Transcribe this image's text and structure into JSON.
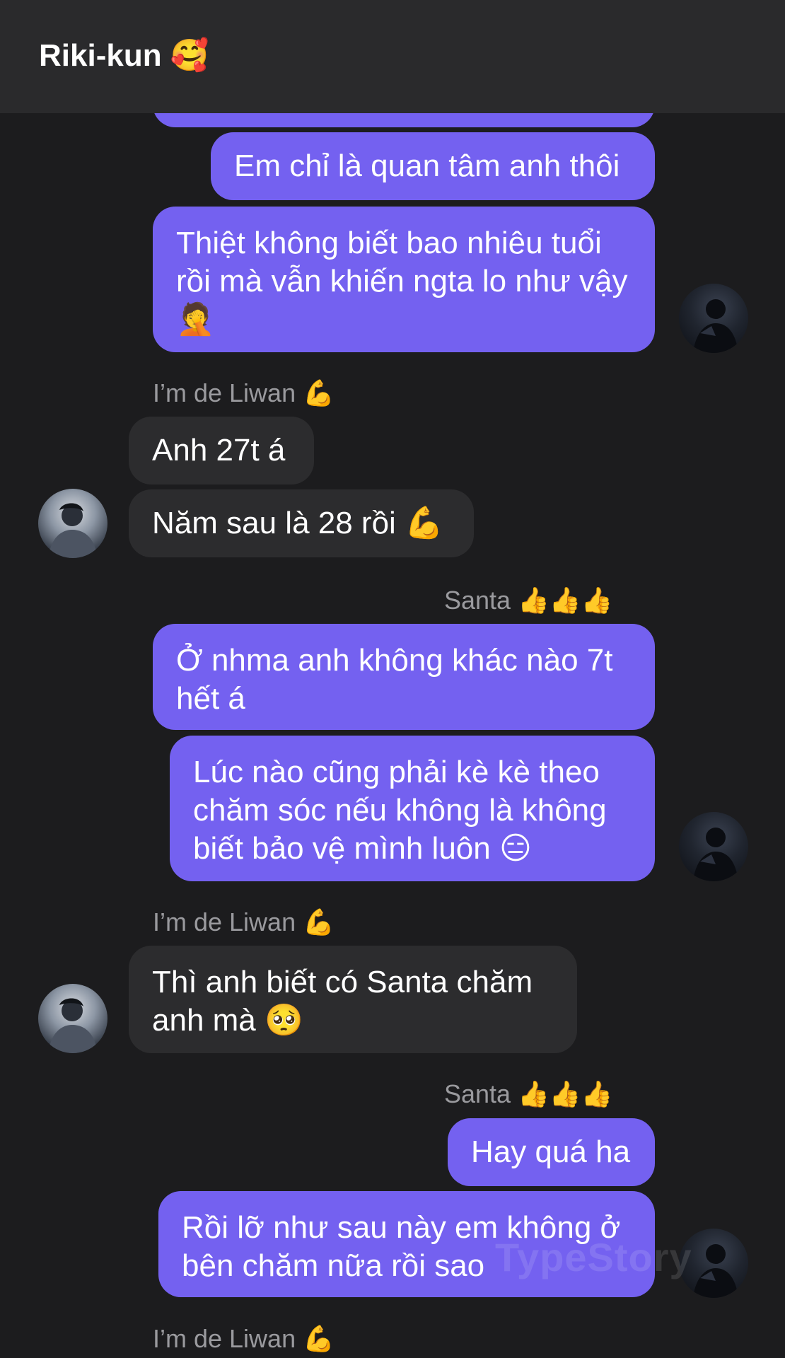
{
  "header": {
    "title": "Riki-kun",
    "title_emoji": "🥰"
  },
  "messages": [
    {
      "text": "Em chỉ là quan tâm anh thôi"
    },
    {
      "text": "Thiệt không biết bao nhiêu tuổi rồi mà vẫn khiến ngta lo như vậy 🤦"
    },
    {
      "sender": "I’m de Liwan 💪"
    },
    {
      "text": "Anh 27t á"
    },
    {
      "text": "Năm sau là 28 rồi 💪"
    },
    {
      "sender": "Santa 👍👍👍"
    },
    {
      "text": "Ở nhma anh không khác nào 7t hết á"
    },
    {
      "text": "Lúc nào cũng phải kè kè theo chăm sóc nếu không là không biết bảo vệ mình luôn 😑"
    },
    {
      "sender": "I’m de Liwan 💪"
    },
    {
      "text": "Thì anh biết có Santa chăm anh mà 🥺"
    },
    {
      "sender": "Santa 👍👍👍"
    },
    {
      "text": "Hay quá ha"
    },
    {
      "text": "Rồi lỡ như sau này em không ở bên chăm nữa rồi sao"
    },
    {
      "sender": "I’m de Liwan 💪"
    }
  ],
  "watermark": "TypeStory",
  "colors": {
    "outgoing_bubble": "#7461f0",
    "incoming_bubble": "#2c2c2e",
    "background": "#1c1c1e",
    "header": "#2a2a2c"
  },
  "icons": [
    "self-avatar",
    "liwan-avatar"
  ]
}
